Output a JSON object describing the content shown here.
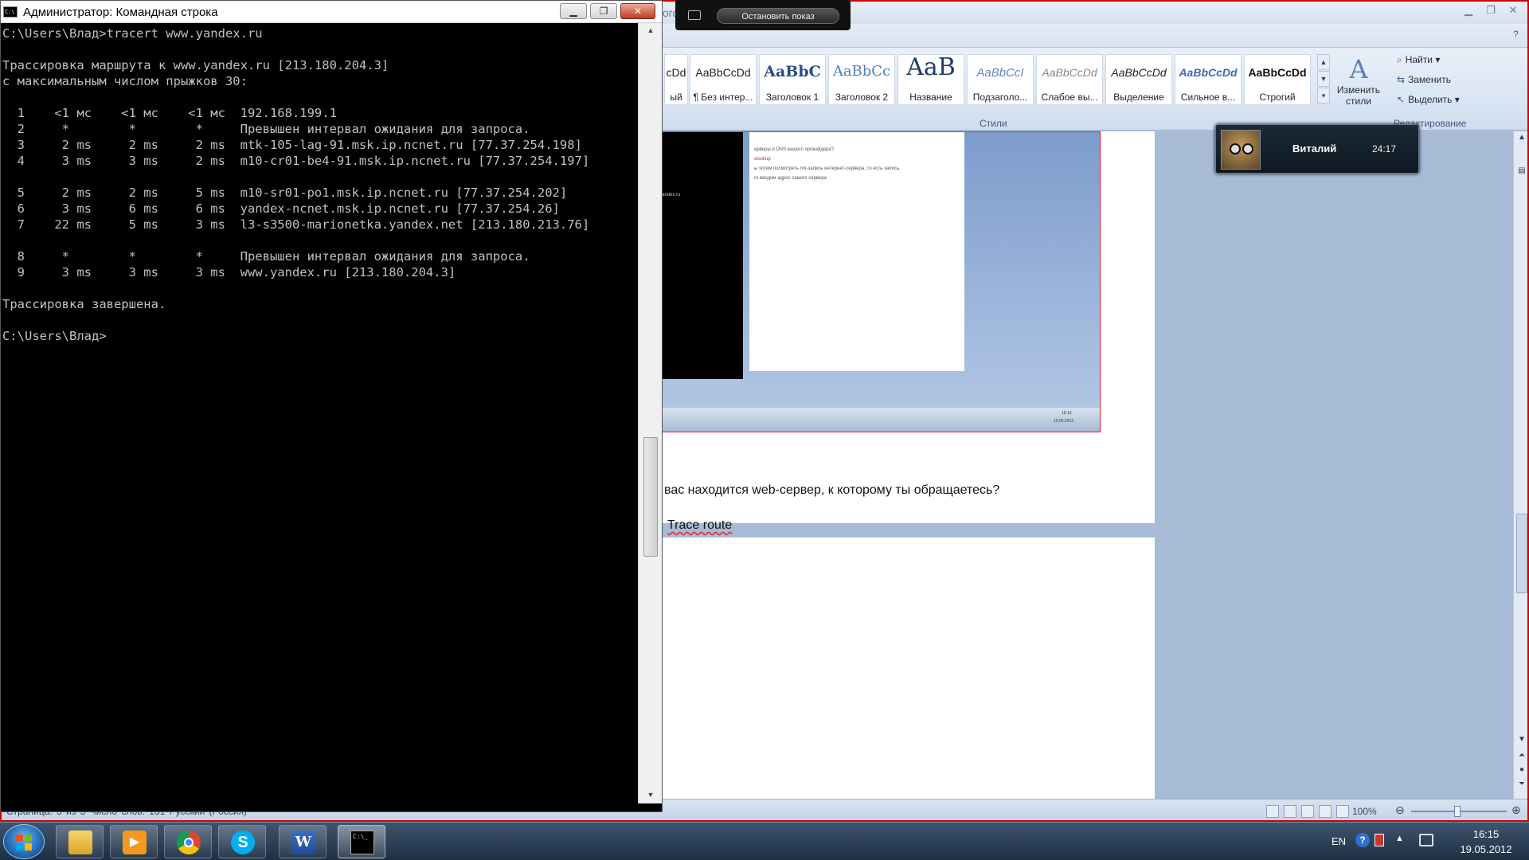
{
  "cmd": {
    "title": "Администратор: Командная строка",
    "lines": [
      "C:\\Users\\Влад>tracert www.yandex.ru",
      "",
      "Трассировка маршрута к www.yandex.ru [213.180.204.3]",
      "с максимальным числом прыжков 30:",
      "",
      "  1    <1 мс    <1 мс    <1 мс  192.168.199.1",
      "  2     *        *        *     Превышен интервал ожидания для запроса.",
      "  3     2 ms     2 ms     2 ms  mtk-105-lag-91.msk.ip.ncnet.ru [77.37.254.198]",
      "  4     3 ms     3 ms     2 ms  m10-cr01-be4-91.msk.ip.ncnet.ru [77.37.254.197]",
      "",
      "  5     2 ms     2 ms     5 ms  m10-sr01-po1.msk.ip.ncnet.ru [77.37.254.202]",
      "  6     3 ms     6 ms     6 ms  yandex-ncnet.msk.ip.ncnet.ru [77.37.254.26]",
      "  7    22 ms     5 ms     3 ms  l3-s3500-marionetka.yandex.net [213.180.213.76]",
      "",
      "  8     *        *        *     Превышен интервал ожидания для запроса.",
      "  9     3 ms     3 ms     3 ms  www.yandex.ru [213.180.204.3]",
      "",
      "Трассировка завершена.",
      "",
      "C:\\Users\\Влад>"
    ]
  },
  "word": {
    "title_fragment": "ord",
    "styles": [
      {
        "sample": "cDd",
        "name": "ый"
      },
      {
        "sample": "AaBbCcDd",
        "name": "¶ Без интер..."
      },
      {
        "sample": "AaBbC",
        "name": "Заголовок 1"
      },
      {
        "sample": "AaBbCc",
        "name": "Заголовок 2"
      },
      {
        "sample": "AaB",
        "name": "Название"
      },
      {
        "sample": "AaBbCcI",
        "name": "Подзаголо..."
      },
      {
        "sample": "AaBbCcDd",
        "name": "Слабое вы..."
      },
      {
        "sample": "AaBbCcDd",
        "name": "Выделение"
      },
      {
        "sample": "AaBbCcDd",
        "name": "Сильное в..."
      },
      {
        "sample": "AaBbCcDd",
        "name": "Строгий"
      }
    ],
    "styles_group": "Стили",
    "change_styles": "Изменить стили",
    "edit": {
      "find": "Найти",
      "replace": "Заменить",
      "select": "Выделить",
      "group": "Редактирование"
    },
    "embedded": {
      "doc_line1": "ерверы и DNS вашего провайдера?",
      "doc_line2": "slookup",
      "doc_line3": "ы хотим посмотреть mx-запись интернет-сервера, то есть запись,",
      "doc_line4": "го вводим адрес самого сервера",
      "console_text": "andex.ru",
      "clock_time": "16:13",
      "clock_date": "19.05.2012"
    },
    "doc_line1": "вас находится web-сервер, к которому ты обращаетесь?",
    "doc_line2": "Trace route",
    "status": {
      "left": "Страница: 3 из 3    Число слов: 131    Русский (Россия)",
      "zoom": "100%"
    }
  },
  "slideshow": {
    "stop_label": "Остановить показ"
  },
  "skype": {
    "name": "Виталий",
    "time": "24:17"
  },
  "taskbar": {
    "apps": [
      "explorer-icon",
      "media-player-icon",
      "chrome-icon",
      "skype-icon",
      "word-icon",
      "cmd-icon"
    ],
    "lang": "EN",
    "time": "16:15",
    "date": "19.05.2012"
  }
}
